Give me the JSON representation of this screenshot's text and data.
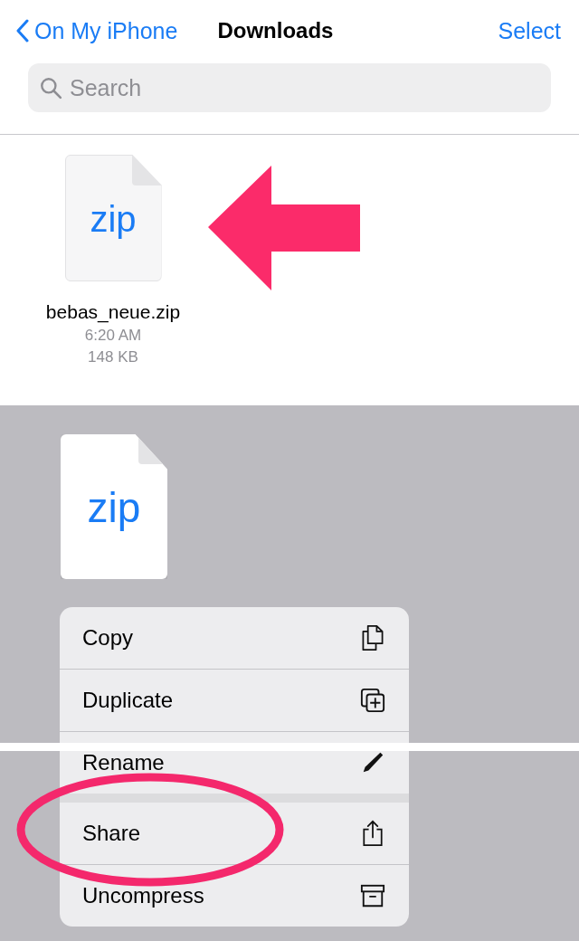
{
  "nav": {
    "back": "On My iPhone",
    "title": "Downloads",
    "action": "Select"
  },
  "search": {
    "placeholder": "Search"
  },
  "files": [
    {
      "badge": "zip",
      "name": "bebas_neue.zip",
      "time": "6:20 AM",
      "size": "148 KB"
    }
  ],
  "preview": {
    "badge": "zip"
  },
  "menu": {
    "sections": [
      [
        {
          "label": "Copy"
        },
        {
          "label": "Duplicate"
        },
        {
          "label": "Rename"
        }
      ],
      [
        {
          "label": "Share"
        },
        {
          "label": "Uncompress"
        }
      ]
    ]
  }
}
